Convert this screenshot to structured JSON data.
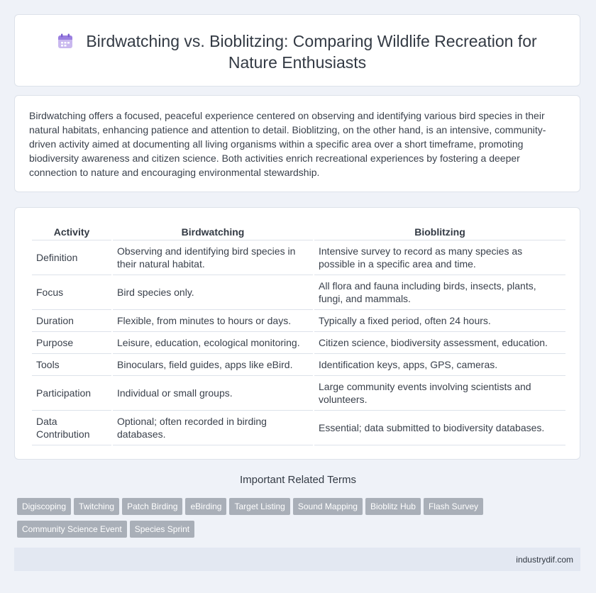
{
  "header": {
    "title": "Birdwatching vs. Bioblitzing: Comparing Wildlife Recreation for Nature Enthusiasts",
    "icon": "calendar-icon"
  },
  "intro": {
    "text": "Birdwatching offers a focused, peaceful experience centered on observing and identifying various bird species in their natural habitats, enhancing patience and attention to detail. Bioblitzing, on the other hand, is an intensive, community-driven activity aimed at documenting all living organisms within a specific area over a short timeframe, promoting biodiversity awareness and citizen science. Both activities enrich recreational experiences by fostering a deeper connection to nature and encouraging environmental stewardship."
  },
  "table": {
    "headers": [
      "Activity",
      "Birdwatching",
      "Bioblitzing"
    ],
    "rows": [
      [
        "Definition",
        "Observing and identifying bird species in their natural habitat.",
        "Intensive survey to record as many species as possible in a specific area and time."
      ],
      [
        "Focus",
        "Bird species only.",
        "All flora and fauna including birds, insects, plants, fungi, and mammals."
      ],
      [
        "Duration",
        "Flexible, from minutes to hours or days.",
        "Typically a fixed period, often 24 hours."
      ],
      [
        "Purpose",
        "Leisure, education, ecological monitoring.",
        "Citizen science, biodiversity assessment, education."
      ],
      [
        "Tools",
        "Binoculars, field guides, apps like eBird.",
        "Identification keys, apps, GPS, cameras."
      ],
      [
        "Participation",
        "Individual or small groups.",
        "Large community events involving scientists and volunteers."
      ],
      [
        "Data Contribution",
        "Optional; often recorded in birding databases.",
        "Essential; data submitted to biodiversity databases."
      ]
    ]
  },
  "related": {
    "title": "Important Related Terms",
    "tags": [
      "Digiscoping",
      "Twitching",
      "Patch Birding",
      "eBirding",
      "Target Listing",
      "Sound Mapping",
      "Bioblitz Hub",
      "Flash Survey",
      "Community Science Event",
      "Species Sprint"
    ]
  },
  "footer": {
    "text": "industrydif.com"
  },
  "colors": {
    "background": "#eff2f8",
    "card": "#ffffff",
    "tag": "#a9afb8",
    "footer": "#e3e8f2"
  }
}
